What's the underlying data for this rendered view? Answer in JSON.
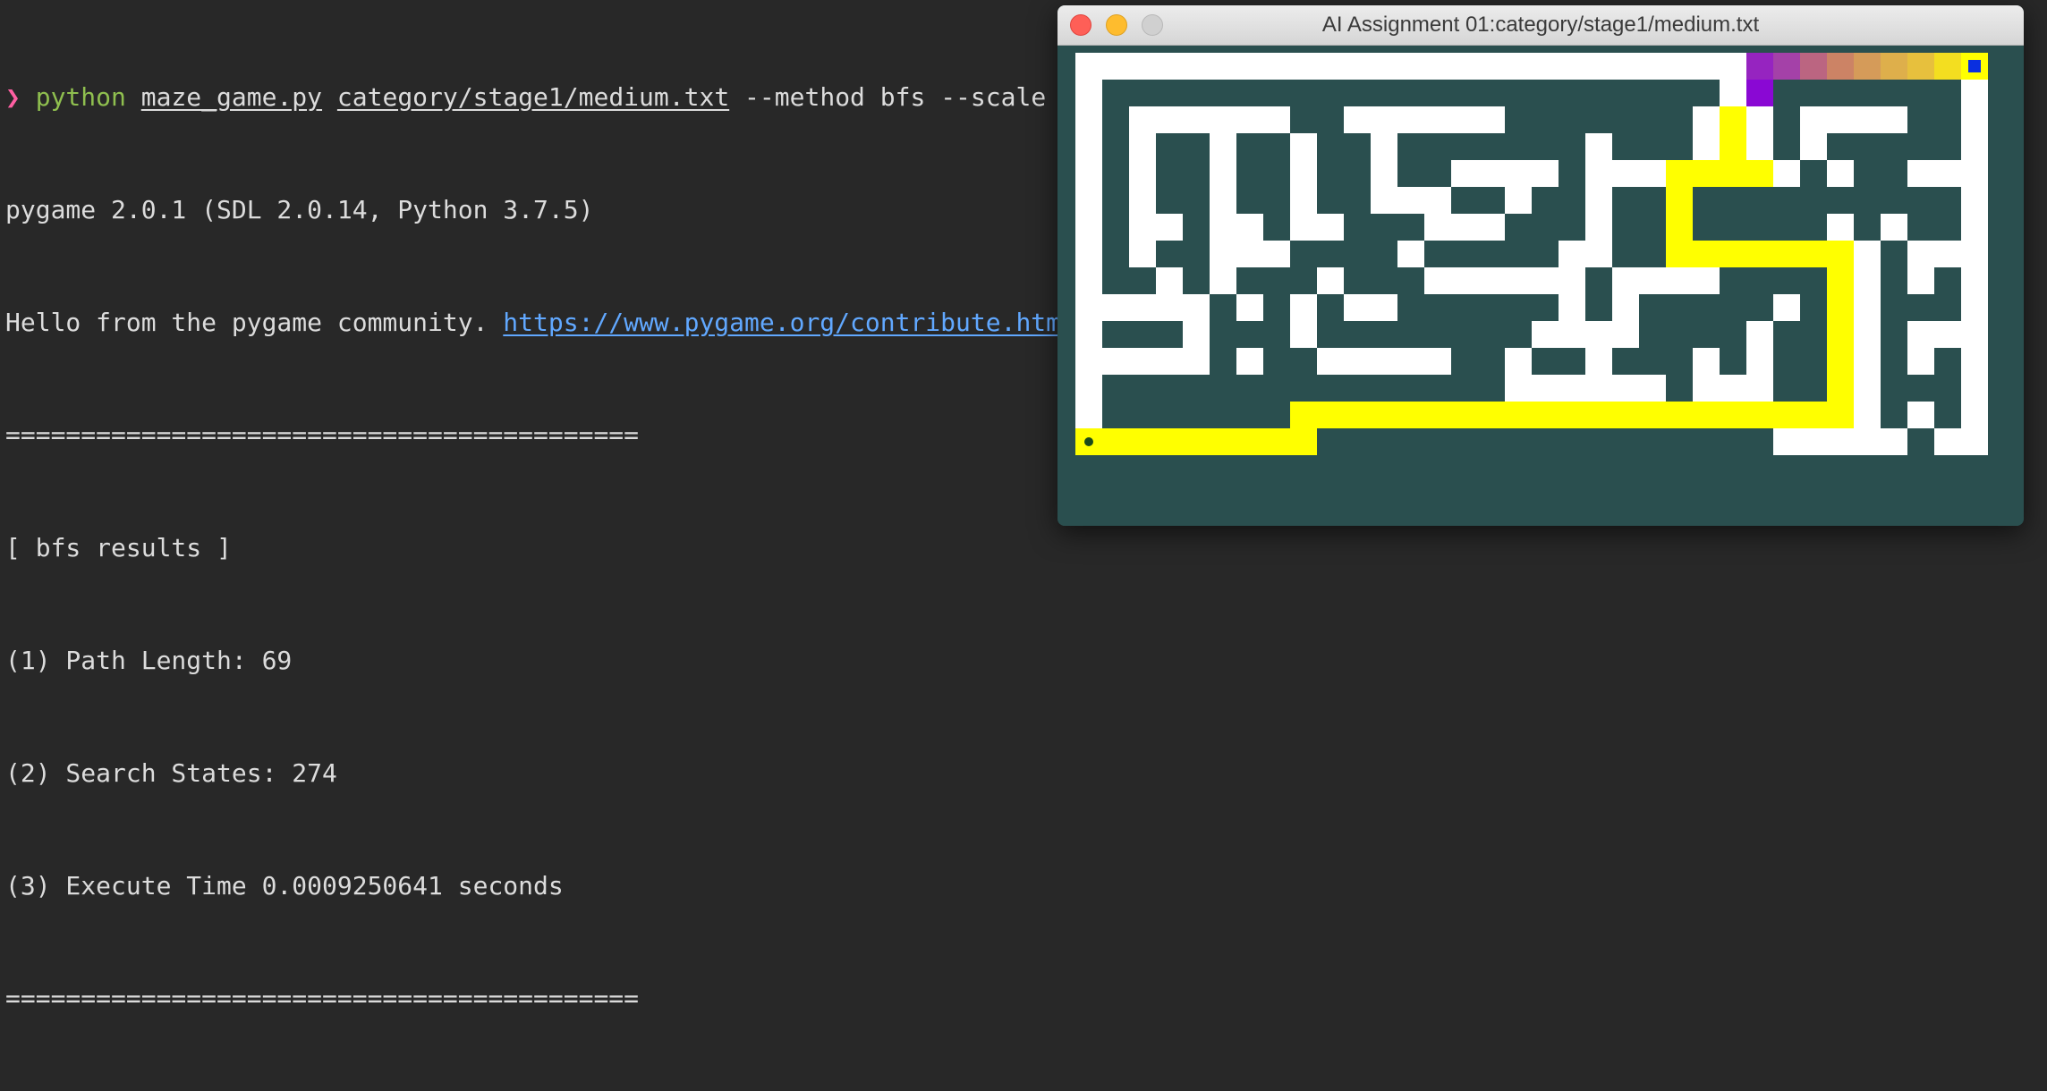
{
  "terminal": {
    "prompt_symbol": "❯",
    "command": {
      "program": "python",
      "script": "maze_game.py",
      "map_path": "category/stage1/medium.txt",
      "args": "--method bfs --scale 15"
    },
    "pygame_version": "pygame 2.0.1 (SDL 2.0.14, Python 3.7.5)",
    "hello_text": "Hello from the pygame community. ",
    "hello_link": "https://www.pygame.org/contribute.html",
    "separator": "==========================================",
    "results_header": "[ bfs results ]",
    "path_length": "(1) Path Length: 69",
    "search_states": "(2) Search States: 274",
    "execute_time": "(3) Execute Time 0.0009250641 seconds",
    "separator_end": "=========================================="
  },
  "window": {
    "title": "AI Assignment 01:category/stage1/medium.txt",
    "colors": {
      "background": "#2a4f4f",
      "wall": "#ffffff",
      "start_marker": "#0a2fe0",
      "goal_marker": "#1a4a1a",
      "path_gradient": [
        "#ffff00",
        "#e9c43a",
        "#d9a454",
        "#c87a6a",
        "#a03ab0",
        "#8a08d4"
      ]
    }
  },
  "maze": {
    "rows": 16,
    "cols": 35,
    "grid": [
      "...................................",
      ".#########################OOOOOOOOS",
      ".#.......................#O.......#",
      ".#.######..######.......#O#.####..#",
      ".#.#..#..#..#.......#...#O#.#.....#",
      ".#.#..#..#..#..####.###OOOO#.#..###",
      ".#.#..#..#..###..#..#..O..........#",
      ".#.##.##.##...###...#..O.....#.#..#",
      ".#.#..###....#.....##..OOOOOOO#.###",
      ".#..#.#...#...######.####....O#.#.#",
      ".#####.#.#.##......#.#.....#.O#...#",
      ".#...#...#........####....#..O#.###",
      ".#####.#..#####..#..#...#.#..O#.#.#",
      ".#...............######.###..O#...#",
      ".#.......OOOOOOOOOOOOOOOOOOOOO#.#.#",
      ".GOOOOOOOO.................#####.##"
    ]
  }
}
